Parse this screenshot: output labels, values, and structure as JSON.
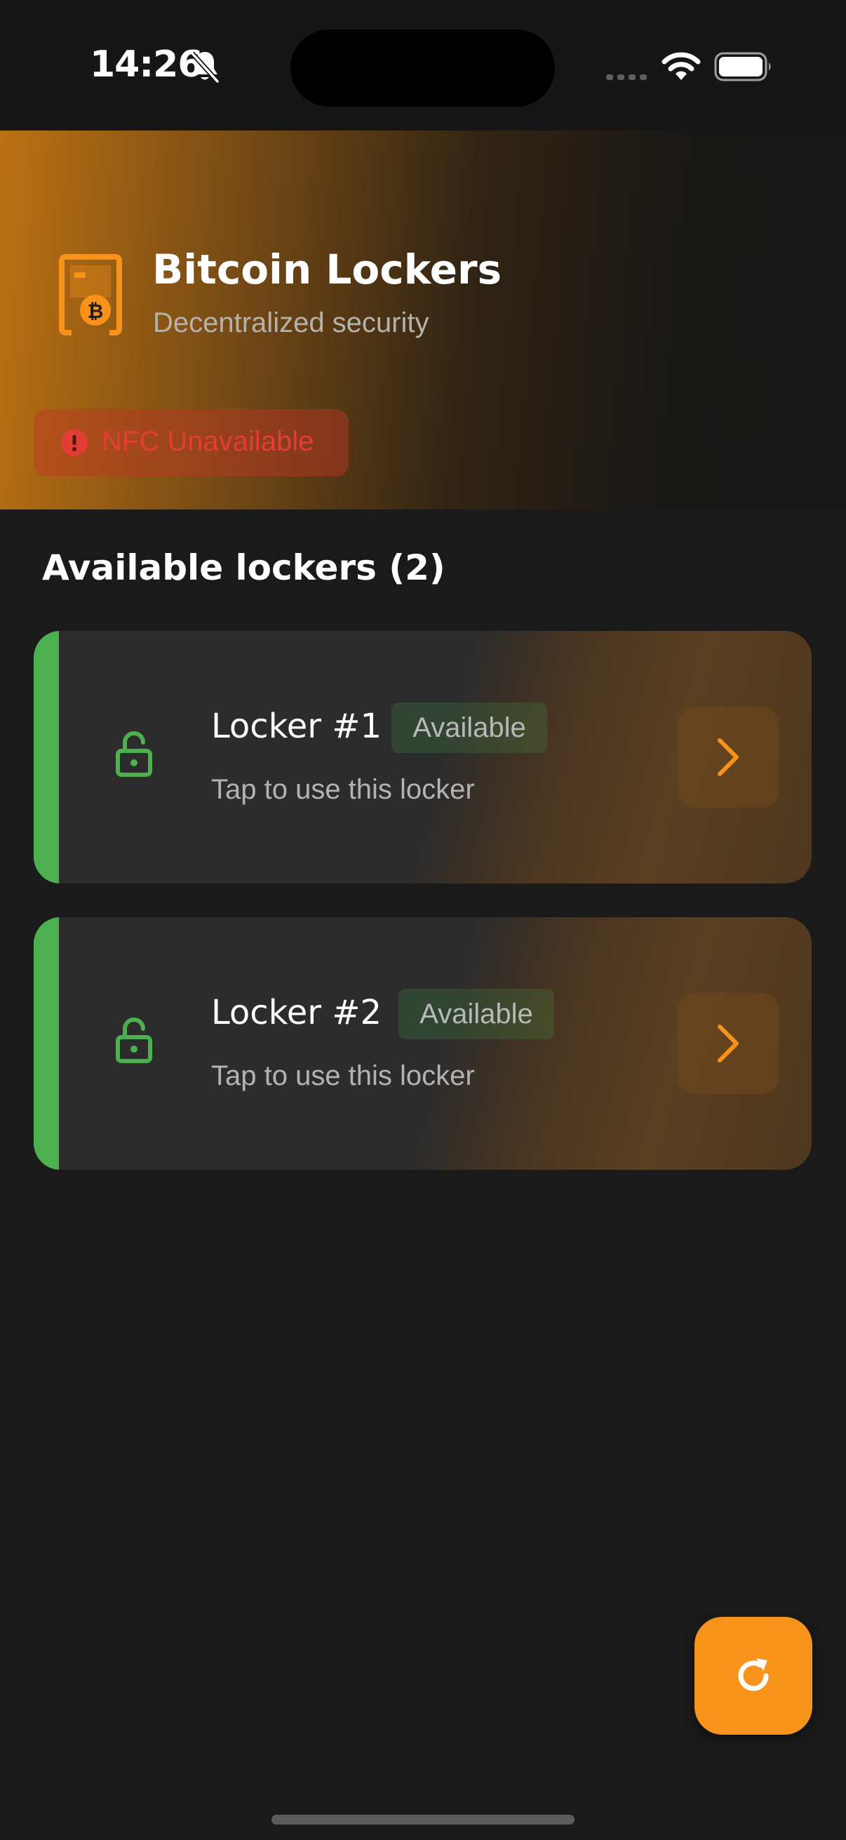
{
  "status_bar": {
    "time": "14:26",
    "icons": [
      "bell-slash-icon",
      "cellular-signal-icon",
      "wifi-icon",
      "battery-icon"
    ]
  },
  "header": {
    "app_icon": "locker-bitcoin-icon",
    "title": "Bitcoin Lockers",
    "subtitle": "Decentralized security",
    "nfc_status": {
      "icon": "alert-circle-icon",
      "label": "NFC Unavailable"
    }
  },
  "section": {
    "title": "Available lockers (2)"
  },
  "lockers": [
    {
      "name": "Locker #1",
      "status": "Available",
      "hint": "Tap to use this locker",
      "icon": "unlocked-padlock-icon",
      "action_icon": "chevron-right-icon"
    },
    {
      "name": "Locker #2",
      "status": "Available",
      "hint": "Tap to use this locker",
      "icon": "unlocked-padlock-icon",
      "action_icon": "chevron-right-icon"
    }
  ],
  "fab": {
    "icon": "refresh-icon"
  },
  "colors": {
    "accent": "#f7931a",
    "available": "#4caf50",
    "error": "#e43d34",
    "background": "#1a1a1a",
    "card": "#2c2c2c"
  }
}
